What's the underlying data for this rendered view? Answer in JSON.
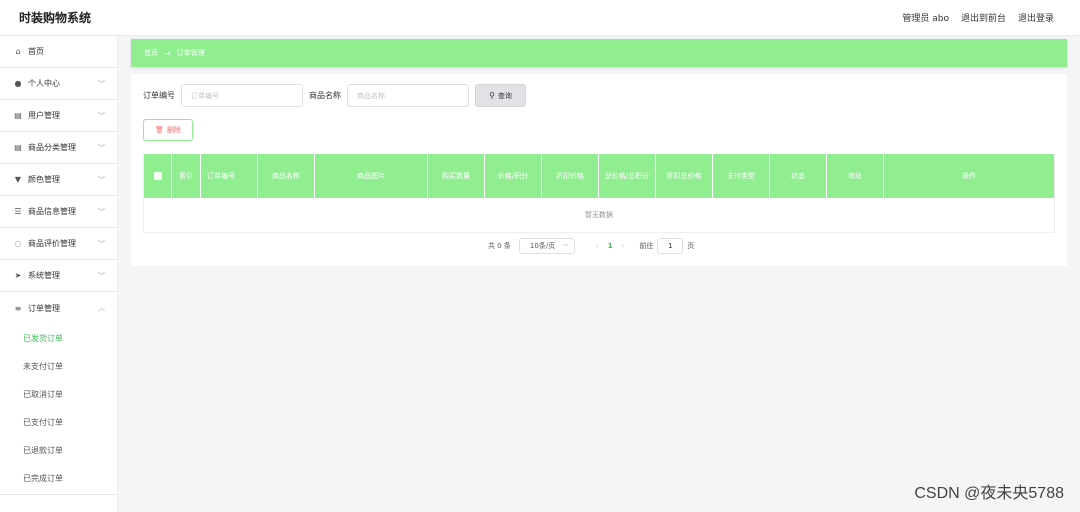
{
  "header": {
    "title": "时装购物系统",
    "links": [
      "管理员 abo",
      "退出到前台",
      "退出登录"
    ]
  },
  "sidebar": {
    "items": [
      {
        "label": "首页",
        "icon": "home-icon",
        "glyph": "⌂",
        "chevron": false
      },
      {
        "label": "个人中心",
        "icon": "user-icon",
        "glyph": "●",
        "chevron": true
      },
      {
        "label": "用户管理",
        "icon": "clipboard-icon",
        "glyph": "▤",
        "chevron": true
      },
      {
        "label": "商品分类管理",
        "icon": "list-icon",
        "glyph": "▤",
        "chevron": true
      },
      {
        "label": "颜色管理",
        "icon": "palette-icon",
        "glyph": "▼",
        "chevron": true
      },
      {
        "label": "商品信息管理",
        "icon": "sliders-icon",
        "glyph": "☰",
        "chevron": true
      },
      {
        "label": "商品评价管理",
        "icon": "chat-icon",
        "glyph": "◌",
        "chevron": true
      },
      {
        "label": "系统管理",
        "icon": "send-icon",
        "glyph": "➤",
        "chevron": true
      },
      {
        "label": "订单管理",
        "icon": "menu-icon",
        "glyph": "≡",
        "chevron": true,
        "expanded": true
      }
    ],
    "sub_items": [
      "已发货订单",
      "未支付订单",
      "已取消订单",
      "已支付订单",
      "已退款订单",
      "已完成订单"
    ],
    "active_sub": "已发货订单"
  },
  "breadcrumb": {
    "home": "首页",
    "separator": "→",
    "current": "订单管理"
  },
  "search": {
    "order_no_label": "订单编号",
    "order_no_placeholder": "订单编号",
    "product_name_label": "商品名称",
    "product_name_placeholder": "商品名称",
    "query_button": "查询"
  },
  "actions": {
    "delete_button": "删除"
  },
  "table": {
    "columns": [
      "",
      "索引",
      "订单编号",
      "商品名称",
      "商品图片",
      "购买数量",
      "价格/积分",
      "折扣价格",
      "总价格/总积分",
      "折扣总价格",
      "支付类型",
      "状态",
      "地址",
      "操作"
    ],
    "empty_text": "暂无数据"
  },
  "pagination": {
    "total": "共 0 条",
    "page_size": "10条/页",
    "current_page": "1",
    "goto_label": "前往",
    "goto_value": "1",
    "page_suffix": "页"
  },
  "watermark": "CSDN @夜未央5788",
  "colors": {
    "accent": "#90ee90",
    "active_text": "#3cbf55",
    "danger": "#f56c6c"
  }
}
